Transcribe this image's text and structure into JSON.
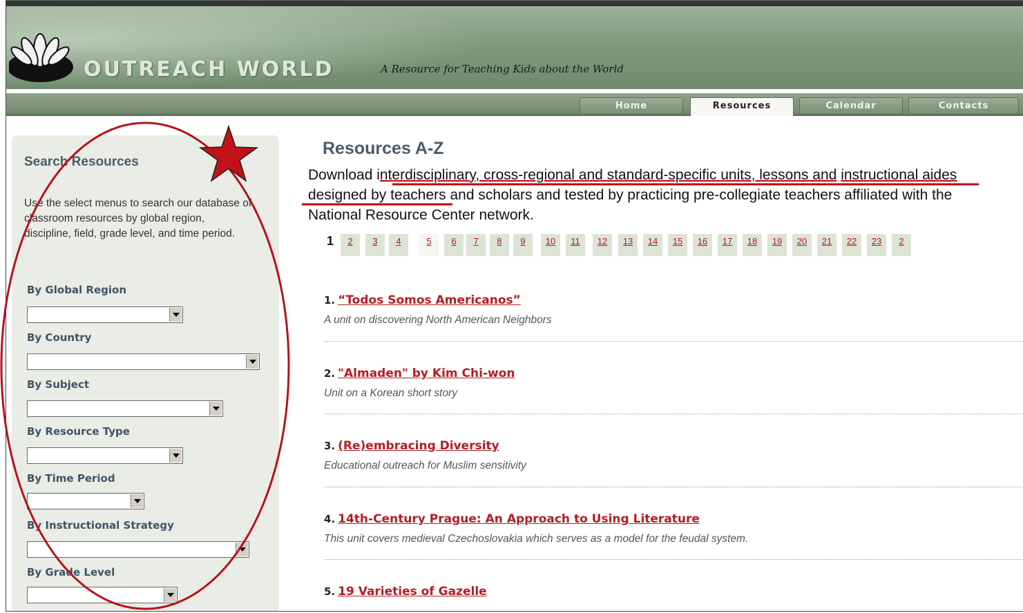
{
  "header": {
    "site_name": "OUTREACH WORLD",
    "tagline": "A Resource for Teaching Kids about the World"
  },
  "nav": {
    "tabs": [
      {
        "label": "Home",
        "active": false
      },
      {
        "label": "Resources",
        "active": true
      },
      {
        "label": "Calendar",
        "active": false
      },
      {
        "label": "Contacts",
        "active": false
      }
    ]
  },
  "sidebar": {
    "title": "Search Resources",
    "description": "Use the select menus to search our database of classroom resources by global region, discipline, field, grade level, and time period.",
    "filters": [
      {
        "label": "By Global Region",
        "value": ""
      },
      {
        "label": "By Country",
        "value": ""
      },
      {
        "label": "By Subject",
        "value": ""
      },
      {
        "label": "By Resource Type",
        "value": ""
      },
      {
        "label": "By Time Period",
        "value": ""
      },
      {
        "label": "By Instructional Strategy",
        "value": ""
      },
      {
        "label": "By Grade Level",
        "value": ""
      }
    ]
  },
  "main": {
    "title": "Resources A-Z",
    "desc_prefix": "Download i",
    "desc_underlined_1": "nterdisciplinary, cross-regional and standard-specific units, lessons and",
    "desc_underlined_2": "instructional aides ",
    "desc_suffix": "designed by teachers and scholars and tested by practicing pre-collegiate teachers affiliated with the National Resource Center network.",
    "pagination": {
      "current": "1",
      "pages": [
        "2",
        "3",
        "4",
        "5",
        "6",
        "7",
        "8",
        "9",
        "10",
        "11",
        "12",
        "13",
        "14",
        "15",
        "16",
        "17",
        "18",
        "19",
        "20",
        "21",
        "22",
        "23",
        "2"
      ]
    },
    "resources": [
      {
        "number": "1.",
        "title": "“Todos Somos Americanos”",
        "subtitle": "A unit on discovering North American Neighbors"
      },
      {
        "number": "2.",
        "title": "\"Almaden\" by Kim Chi-won",
        "subtitle": "Unit on a Korean short story"
      },
      {
        "number": "3.",
        "title": "(Re)embracing Diversity",
        "subtitle": "Educational outreach for Muslim sensitivity"
      },
      {
        "number": "4.",
        "title": "14th-Century Prague: An Approach to Using Literature",
        "subtitle": "This unit covers medieval Czechoslovakia which serves as a model for the feudal system."
      },
      {
        "number": "5.",
        "title": "19 Varieties of Gazelle",
        "subtitle": ""
      }
    ]
  },
  "colors": {
    "annotation_red": "#b5121b",
    "link_red": "#b41d24",
    "banner_green": "#7f9a7e",
    "sidebar_bg": "#eaede5"
  },
  "icons": {
    "logo": "lotus-logo-icon",
    "annotation_star": "star-icon",
    "select_arrow": "chevron-down-icon"
  }
}
